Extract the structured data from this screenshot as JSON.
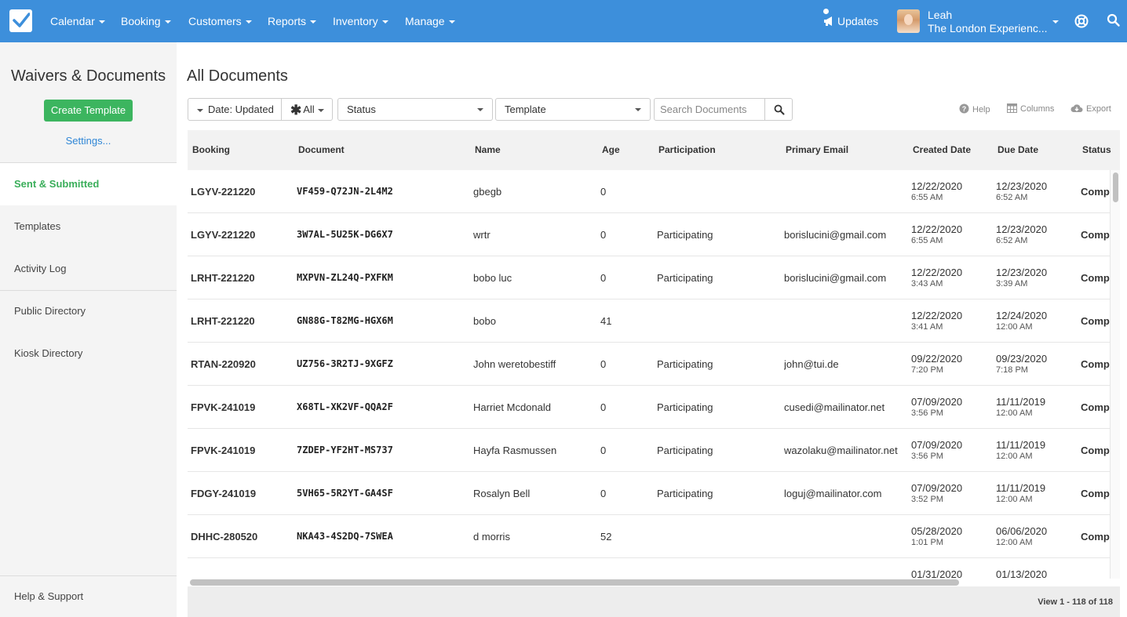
{
  "nav": {
    "items": [
      "Calendar",
      "Booking",
      "Customers",
      "Reports",
      "Inventory",
      "Manage"
    ],
    "updates_label": "Updates",
    "user_name": "Leah",
    "user_company": "The London Experienc..."
  },
  "sidebar": {
    "title": "Waivers & Documents",
    "create_button": "Create Template",
    "settings_link": "Settings...",
    "items": [
      "Sent & Submitted",
      "Templates",
      "Activity Log",
      "Public Directory",
      "Kiosk Directory"
    ],
    "active_item": "Sent & Submitted",
    "help": "Help & Support"
  },
  "main": {
    "title": "All Documents",
    "filters": {
      "date": "Date: Updated",
      "all": "All",
      "status": "Status",
      "template": "Template"
    },
    "search_placeholder": "Search Documents",
    "tools": {
      "help": "Help",
      "columns": "Columns",
      "export": "Export"
    },
    "footer": "View 1 - 118 of 118"
  },
  "table": {
    "columns": [
      "Booking",
      "Document",
      "Name",
      "Age",
      "Participation",
      "Primary Email",
      "Created Date",
      "Due Date",
      "Status"
    ],
    "rows": [
      {
        "booking": "LGYV-221220",
        "document": "VF459-Q72JN-2L4M2",
        "name": "gbegb",
        "age": "0",
        "participation": "",
        "email": "",
        "created_date": "12/22/2020",
        "created_time": "6:55 AM",
        "due_date": "12/23/2020",
        "due_time": "6:52 AM",
        "status": "Comp"
      },
      {
        "booking": "LGYV-221220",
        "document": "3W7AL-5U25K-DG6X7",
        "name": "wrtr",
        "age": "0",
        "participation": "Participating",
        "email": "borislucini@gmail.com",
        "created_date": "12/22/2020",
        "created_time": "6:55 AM",
        "due_date": "12/23/2020",
        "due_time": "6:52 AM",
        "status": "Comp"
      },
      {
        "booking": "LRHT-221220",
        "document": "MXPVN-ZL24Q-PXFKM",
        "name": "bobo luc",
        "age": "0",
        "participation": "Participating",
        "email": "borislucini@gmail.com",
        "created_date": "12/22/2020",
        "created_time": "3:43 AM",
        "due_date": "12/23/2020",
        "due_time": "3:39 AM",
        "status": "Comp"
      },
      {
        "booking": "LRHT-221220",
        "document": "GN88G-T82MG-HGX6M",
        "name": "bobo",
        "age": "41",
        "participation": "",
        "email": "",
        "created_date": "12/22/2020",
        "created_time": "3:41 AM",
        "due_date": "12/24/2020",
        "due_time": "12:00 AM",
        "status": "Comp"
      },
      {
        "booking": "RTAN-220920",
        "document": "UZ756-3R2TJ-9XGFZ",
        "name": "John weretobestiff",
        "age": "0",
        "participation": "Participating",
        "email": "john@tui.de",
        "created_date": "09/22/2020",
        "created_time": "7:20 PM",
        "due_date": "09/23/2020",
        "due_time": "7:18 PM",
        "status": "Comp"
      },
      {
        "booking": "FPVK-241019",
        "document": "X68TL-XK2VF-QQA2F",
        "name": "Harriet Mcdonald",
        "age": "0",
        "participation": "Participating",
        "email": "cusedi@mailinator.net",
        "created_date": "07/09/2020",
        "created_time": "3:56 PM",
        "due_date": "11/11/2019",
        "due_time": "12:00 AM",
        "status": "Comp"
      },
      {
        "booking": "FPVK-241019",
        "document": "7ZDEP-YF2HT-MS737",
        "name": "Hayfa Rasmussen",
        "age": "0",
        "participation": "Participating",
        "email": "wazolaku@mailinator.net",
        "created_date": "07/09/2020",
        "created_time": "3:56 PM",
        "due_date": "11/11/2019",
        "due_time": "12:00 AM",
        "status": "Comp"
      },
      {
        "booking": "FDGY-241019",
        "document": "5VH65-5R2YT-GA4SF",
        "name": "Rosalyn Bell",
        "age": "0",
        "participation": "Participating",
        "email": "loguj@mailinator.com",
        "created_date": "07/09/2020",
        "created_time": "3:52 PM",
        "due_date": "11/11/2019",
        "due_time": "12:00 AM",
        "status": "Comp"
      },
      {
        "booking": "DHHC-280520",
        "document": "NKA43-4S2DQ-7SWEA",
        "name": "d morris",
        "age": "52",
        "participation": "",
        "email": "",
        "created_date": "05/28/2020",
        "created_time": "1:01 PM",
        "due_date": "06/06/2020",
        "due_time": "12:00 AM",
        "status": "Comp"
      },
      {
        "booking": "",
        "document": "",
        "name": "",
        "age": "",
        "participation": "",
        "email": "",
        "created_date": "01/31/2020",
        "created_time": "",
        "due_date": "01/13/2020",
        "due_time": "",
        "status": ""
      }
    ]
  }
}
